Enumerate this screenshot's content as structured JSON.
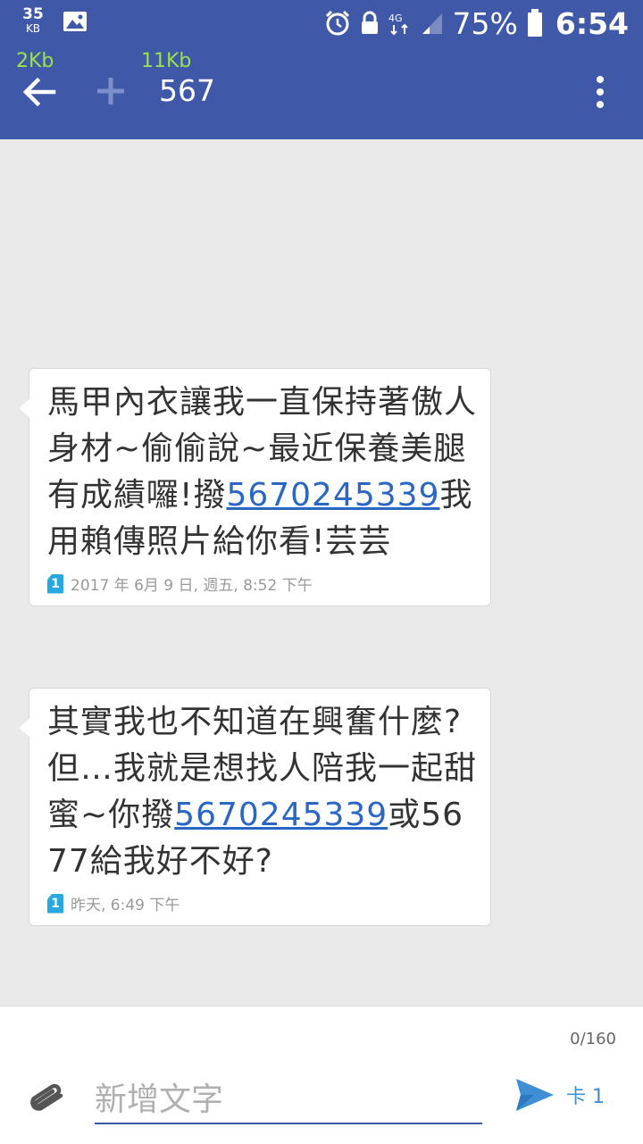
{
  "status_bar": {
    "net_rate_value": "35",
    "net_rate_unit": "KB",
    "battery": "75%",
    "time": "6:54",
    "icons": [
      "image-icon",
      "alarm-icon",
      "lock-icon",
      "4g-lte-icon",
      "signal-icon",
      "battery-icon"
    ]
  },
  "speeds": {
    "upload": "2Kb",
    "download": "11Kb"
  },
  "header": {
    "title": "567",
    "icons": [
      "back-arrow-icon",
      "plus-icon",
      "more-vert-icon"
    ]
  },
  "messages": [
    {
      "parts": [
        {
          "type": "text",
          "value": "馬甲內衣讓我一直保持著傲人身材~偷偷說~最近保養美腿有成績囉!撥"
        },
        {
          "type": "link",
          "value": "5670245339"
        },
        {
          "type": "text",
          "value": "我用賴傳照片給你看!芸芸"
        }
      ],
      "sim": "1",
      "timestamp": "2017 年 6月 9 日, 週五, 8:52 下午"
    },
    {
      "parts": [
        {
          "type": "text",
          "value": "其實我也不知道在興奮什麼?但…我就是想找人陪我一起甜蜜~你撥"
        },
        {
          "type": "link",
          "value": "5670245339"
        },
        {
          "type": "text",
          "value": "或5677給我好不好?"
        }
      ],
      "sim": "1",
      "timestamp": "昨天, 6:49 下午"
    }
  ],
  "composer": {
    "char_count": "0/160",
    "placeholder": "新增文字",
    "send_label": "卡 1"
  },
  "colors": {
    "app_bar": "#3f58a8",
    "link": "#2a66c4",
    "speed": "#9be04e",
    "send": "#3f8fd6"
  }
}
